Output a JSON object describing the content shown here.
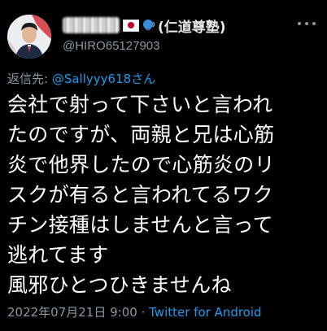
{
  "author": {
    "display_name_suffix": "(仁道尊塾)",
    "handle": "@HIRO65127903",
    "flag_icon": "japan-flag-icon",
    "speaker_icon": "speaking-head-icon"
  },
  "reply": {
    "label": "返信先: ",
    "mention": "@Sallyyy618さん"
  },
  "tweet": {
    "lines": [
      "会社で射って下さいと言われ",
      "たのですが、両親と兄は心筋",
      "炎で他界したので心筋炎のリ",
      "スクが有ると言われてるワク",
      "チン接種はしませんと言って",
      "逃れてます",
      "風邪ひとつひきませんね"
    ]
  },
  "meta": {
    "timestamp": "2022年07月21日 9:00",
    "separator": " · ",
    "source": "Twitter for Android"
  },
  "colors": {
    "background": "#000000",
    "text": "#ffffff",
    "secondary": "#8b98a5",
    "link": "#1d9bf0"
  }
}
